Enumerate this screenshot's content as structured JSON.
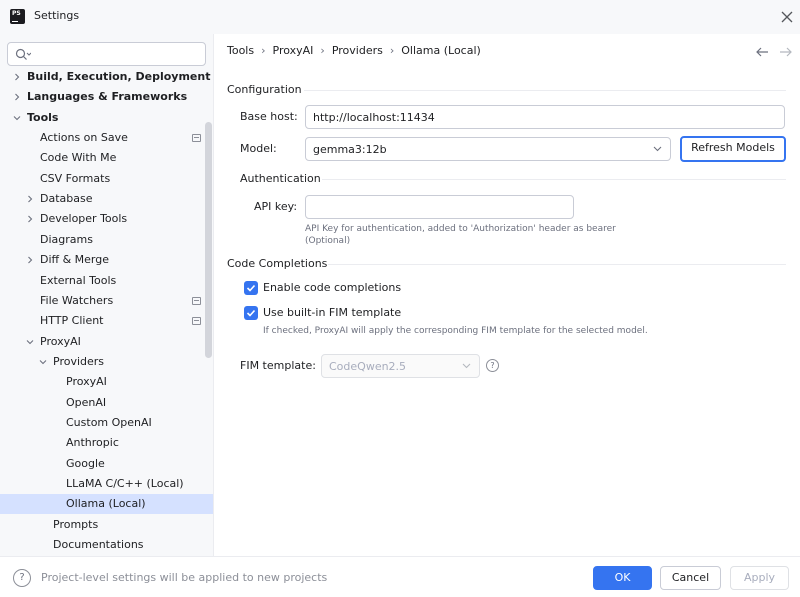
{
  "window": {
    "title": "Settings",
    "app_icon_text": "PS"
  },
  "colors": {
    "accent": "#3574f0",
    "selection": "#d5e1ff",
    "sidebar_bg": "#f7f8fa",
    "text": "#1e1f22",
    "muted": "#6c707e"
  },
  "sidebar": {
    "search": {
      "placeholder": "",
      "value": ""
    },
    "items": [
      {
        "label": "Build, Execution, Deployment",
        "bold": true,
        "chevron": "right",
        "project_icon": false
      },
      {
        "label": "Languages & Frameworks",
        "bold": true,
        "chevron": "right",
        "project_icon": false
      },
      {
        "label": "Tools",
        "bold": true,
        "chevron": "down",
        "project_icon": false
      },
      {
        "label": "Actions on Save",
        "chevron": "none",
        "project_icon": true
      },
      {
        "label": "Code With Me",
        "chevron": "none",
        "project_icon": false
      },
      {
        "label": "CSV Formats",
        "chevron": "none",
        "project_icon": false
      },
      {
        "label": "Database",
        "chevron": "right",
        "project_icon": false
      },
      {
        "label": "Developer Tools",
        "chevron": "right",
        "project_icon": false
      },
      {
        "label": "Diagrams",
        "chevron": "none",
        "project_icon": false
      },
      {
        "label": "Diff & Merge",
        "chevron": "right",
        "project_icon": false
      },
      {
        "label": "External Tools",
        "chevron": "none",
        "project_icon": false
      },
      {
        "label": "File Watchers",
        "chevron": "none",
        "project_icon": true
      },
      {
        "label": "HTTP Client",
        "chevron": "none",
        "project_icon": true
      },
      {
        "label": "ProxyAI",
        "chevron": "down",
        "project_icon": false
      },
      {
        "label": "Providers",
        "chevron": "down",
        "project_icon": false
      },
      {
        "label": "ProxyAI",
        "chevron": "none",
        "project_icon": false
      },
      {
        "label": "OpenAI",
        "chevron": "none",
        "project_icon": false
      },
      {
        "label": "Custom OpenAI",
        "chevron": "none",
        "project_icon": false
      },
      {
        "label": "Anthropic",
        "chevron": "none",
        "project_icon": false
      },
      {
        "label": "Google",
        "chevron": "none",
        "project_icon": false
      },
      {
        "label": "LLaMA C/C++ (Local)",
        "chevron": "none",
        "project_icon": false
      },
      {
        "label": "Ollama (Local)",
        "chevron": "none",
        "project_icon": false,
        "selected": true
      },
      {
        "label": "Prompts",
        "chevron": "none",
        "project_icon": false
      },
      {
        "label": "Documentations",
        "chevron": "none",
        "project_icon": false
      }
    ]
  },
  "breadcrumb": [
    "Tools",
    "ProxyAI",
    "Providers",
    "Ollama (Local)"
  ],
  "configuration": {
    "title": "Configuration",
    "base_host_label": "Base host:",
    "base_host_value": "http://localhost:11434",
    "model_label": "Model:",
    "model_value": "gemma3:12b",
    "refresh_button": "Refresh Models"
  },
  "authentication": {
    "title": "Authentication",
    "api_key_label": "API key:",
    "api_key_value": "",
    "api_key_hint_line1": "API Key for authentication, added to 'Authorization' header as bearer",
    "api_key_hint_line2": "(Optional)"
  },
  "code_completions": {
    "title": "Code Completions",
    "enable_label": "Enable code completions",
    "enable_checked": true,
    "fim_label": "Use built-in FIM template",
    "fim_checked": true,
    "fim_hint": "If checked, ProxyAI will apply the corresponding FIM template for the selected model.",
    "fim_template_label": "FIM template:",
    "fim_template_value": "CodeQwen2.5",
    "help_glyph": "?"
  },
  "footer": {
    "help_glyph": "?",
    "note": "Project-level settings will be applied to new projects",
    "ok": "OK",
    "cancel": "Cancel",
    "apply": "Apply"
  }
}
